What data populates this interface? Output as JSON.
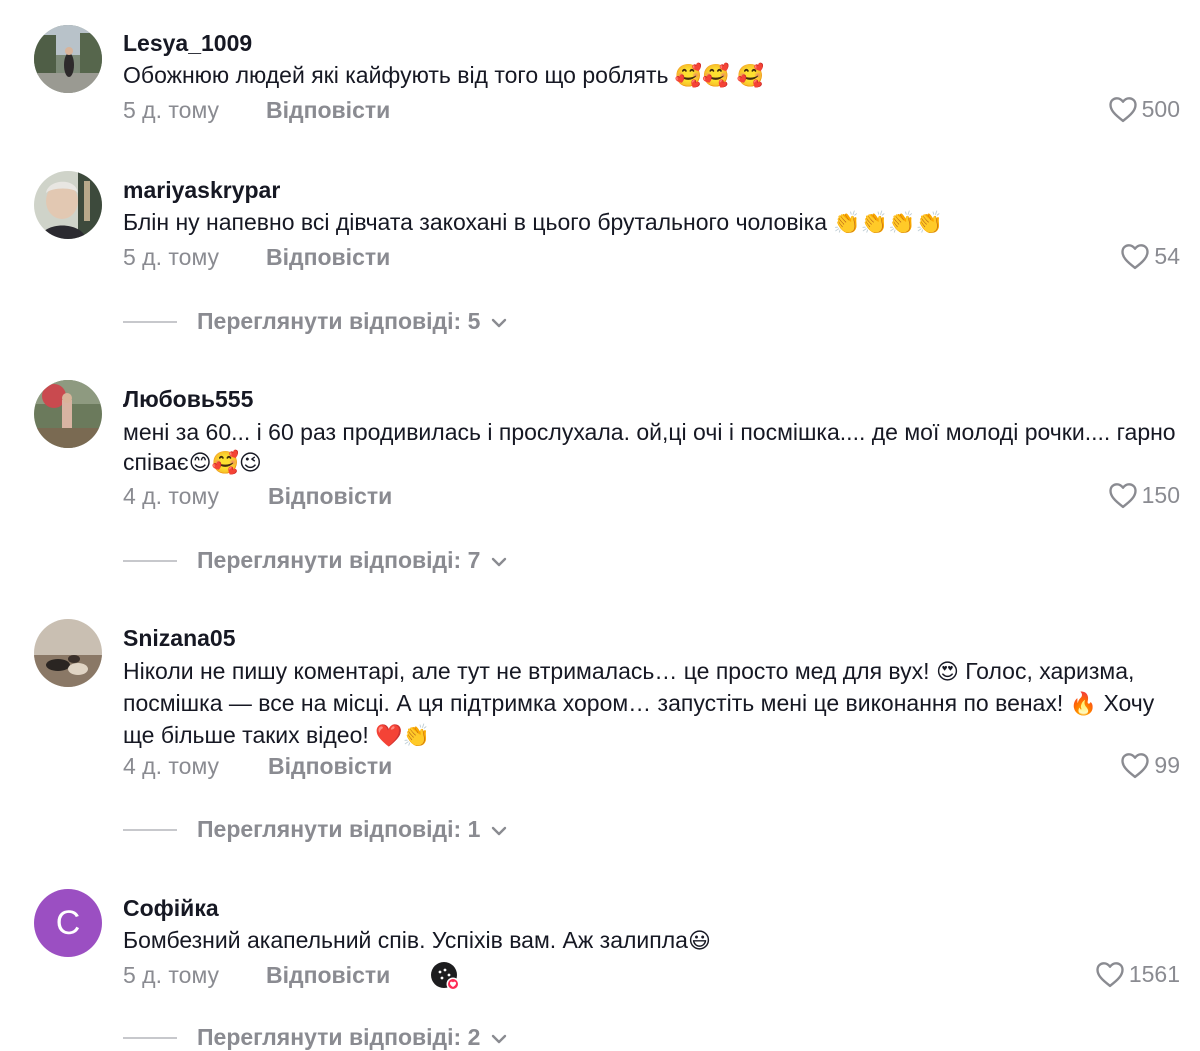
{
  "comments": [
    {
      "username": "Lesya_1009",
      "text": "Обожнюю людей які кайфують від того що роблять",
      "emoji": "🥰🥰 🥰",
      "time": "5 д. тому",
      "reply_label": "Відповісти",
      "likes": "500"
    },
    {
      "username": "mariyaskrypar",
      "text": "Блін ну напевно всі дівчата закохані в цього брутального чоловіка",
      "emoji": "👏👏👏👏",
      "time": "5 д. тому",
      "reply_label": "Відповісти",
      "likes": "54",
      "view_replies": "Переглянути відповіді: 5"
    },
    {
      "username": "Любовь555",
      "text": "мені за 60... і 60 раз продивилась і прослухала. ой,ці очі і посмішка.... де мої молоді рочки.... гарно співає",
      "emoji": "😊🥰😉",
      "time": "4 д. тому",
      "reply_label": "Відповісти",
      "likes": "150",
      "view_replies": "Переглянути відповіді: 7"
    },
    {
      "username": "Snizana05",
      "text_part1": "Ніколи не пишу коментарі, але тут не втрималась… це просто мед для вух!",
      "emoji1": "😍",
      "text_part2": "Голос, харизма, посмішка — все на місці. А ця підтримка хором… запустіть мені це виконання по венах!",
      "emoji2": "🔥",
      "text_part3": "Хочу ще більше таких відео!",
      "emoji3": "❤️👏",
      "time": "4 д. тому",
      "reply_label": "Відповісти",
      "likes": "99",
      "view_replies": "Переглянути відповіді: 1"
    },
    {
      "username": "Софійка",
      "avatar_letter": "С",
      "text": "Бомбезний акапельний спів. Успіхів вам. Аж залипла",
      "emoji": "😃",
      "time": "5 д. тому",
      "reply_label": "Відповісти",
      "likes": "1561",
      "view_replies": "Переглянути відповіді: 2"
    }
  ],
  "colors": {
    "primary_text": "#161823",
    "secondary_text": "#8a8b91",
    "avatar_letter_bg": "#9b4fc2"
  },
  "icons": {
    "like": "heart-outline-icon",
    "expand": "chevron-down-icon",
    "creator_liked": "creator-liked-badge-icon"
  }
}
